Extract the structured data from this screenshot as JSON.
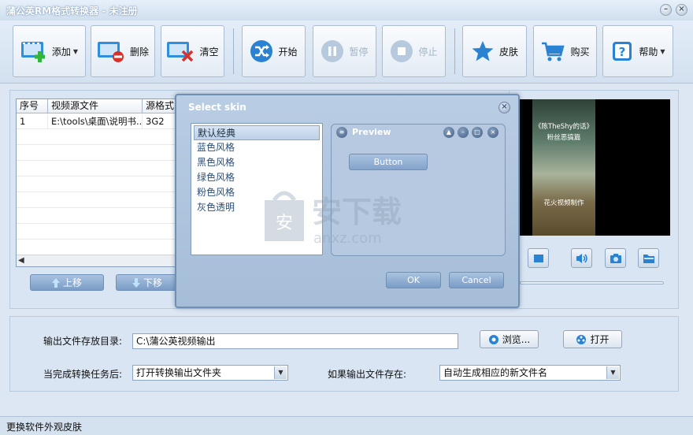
{
  "window": {
    "title": "蒲公英RM格式转换器 - 未注册",
    "controls": [
      "minimize-icon",
      "close-icon"
    ]
  },
  "toolbar": {
    "add": "添加",
    "delete": "删除",
    "clear": "清空",
    "start": "开始",
    "pause": "暂停",
    "stop": "停止",
    "skin": "皮肤",
    "buy": "购买",
    "help": "帮助"
  },
  "file_table": {
    "headers": [
      "序号",
      "视频源文件",
      "源格式"
    ],
    "rows": [
      {
        "index": "1",
        "file": "E:\\tools\\桌面\\说明书...",
        "format": "3G2"
      }
    ]
  },
  "list_buttons": {
    "up": "上移",
    "down": "下移"
  },
  "video": {
    "caption_top": "《陈TheShy的话》",
    "caption_mid": "粉丝恶搞篇",
    "caption_bottom": "花火视频制作"
  },
  "output": {
    "dir_label": "输出文件存放目录:",
    "dir_value": "C:\\蒲公英视频输出",
    "browse": "浏览...",
    "open": "打开",
    "after_label": "当完成转换任务后:",
    "after_value": "打开转换输出文件夹",
    "exists_label": "如果输出文件存在:",
    "exists_value": "自动生成相应的新文件名"
  },
  "status": {
    "text": "更换软件外观皮肤"
  },
  "dialog": {
    "title": "Select skin",
    "skins": [
      "默认经典",
      "蓝色风格",
      "黑色风格",
      "绿色风格",
      "粉色风格",
      "灰色透明"
    ],
    "selected_skin": "默认经典",
    "preview_title": "Preview",
    "preview_button": "Button",
    "ok": "OK",
    "cancel": "Cancel"
  },
  "watermark": {
    "text": "安下载",
    "sub": "anxz.com"
  },
  "colors": {
    "accent": "#3a7fd0",
    "window_bg": "#dce7f3",
    "dialog_bg": "#b0c6df"
  }
}
